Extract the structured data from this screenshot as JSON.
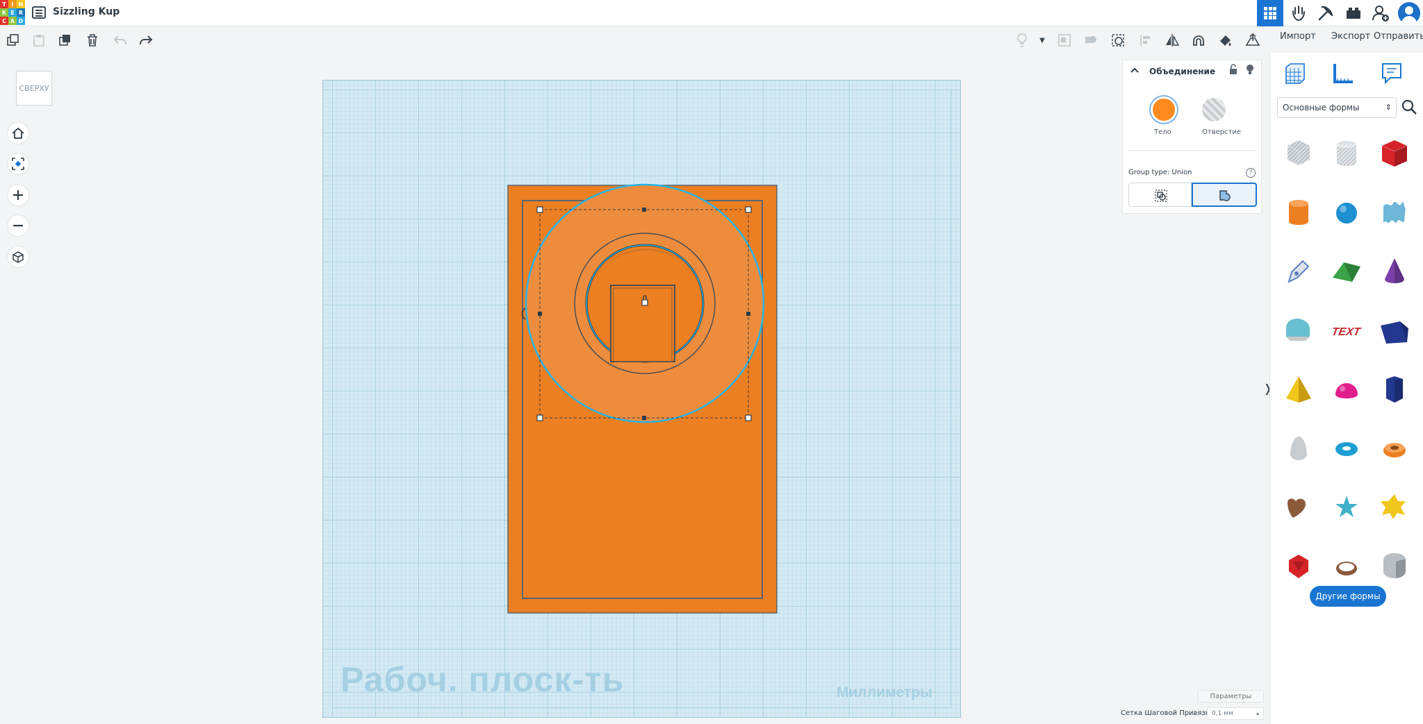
{
  "app": {
    "logo_letters": [
      "T",
      "I",
      "N",
      "K",
      "E",
      "R",
      "C",
      "A",
      "D"
    ],
    "logo_colors": [
      "#e2322b",
      "#f59b1c",
      "#f6c81b",
      "#8cc63f",
      "#2ea8e0",
      "#1b75bc",
      "#e2322b",
      "#8cc63f",
      "#2ea8e0"
    ],
    "project_title": "Sizzling Kup"
  },
  "header": {
    "icons": [
      "grid-view-icon",
      "gallery-icon",
      "pickaxe-icon",
      "bricks-icon",
      "add-user-icon",
      "user-avatar-icon"
    ],
    "accent": "#1a75d2"
  },
  "toolbar": {
    "left_icons": [
      "copy-icon",
      "paste-icon",
      "duplicate-icon",
      "delete-icon",
      "undo-icon",
      "redo-icon"
    ],
    "right_icons": [
      "light-bulb-icon",
      "chevron-down-icon",
      "group-icon",
      "ungroup-icon",
      "cruise-icon",
      "align-icon",
      "mirror-icon",
      "magnet-icon",
      "paint-icon",
      "workplane-icon"
    ],
    "import_label": "Импорт",
    "export_label": "Экспорт",
    "send_label": "Отправить"
  },
  "view": {
    "cube_face_label": "СВЕРХУ",
    "nav_icons": [
      "home-icon",
      "fit-view-icon",
      "zoom-in-icon",
      "zoom-out-icon",
      "perspective-icon"
    ]
  },
  "workplane": {
    "label": "Рабоч. плоск-ть",
    "units": "Миллиметры",
    "plane_color": "#d4eaf4",
    "shape_color": "#ec7f22",
    "selection_color": "#25b5e8"
  },
  "inspector": {
    "title": "Объединение",
    "solid_label": "Тело",
    "hole_label": "Отверстие",
    "solid_color": "#ff8a1e",
    "group_type_label": "Group type: Union",
    "help_symbol": "?"
  },
  "settings": {
    "params_label": "Параметры",
    "snap_label": "Сетка Шаговой Привязки",
    "snap_value": "0,1 мм"
  },
  "shapes_panel": {
    "tabs": [
      "workplane-tab-icon",
      "ruler-tab-icon",
      "notes-tab-icon"
    ],
    "category": "Основные формы",
    "more_label": "Другие формы",
    "collapse_symbol": "❭",
    "text_shape_label": "TEXT",
    "shapes": [
      {
        "name": "box-hole",
        "color": "#b9bec4"
      },
      {
        "name": "cylinder-hole",
        "color": "#c7ccd1"
      },
      {
        "name": "box",
        "color": "#d6232a"
      },
      {
        "name": "cylinder",
        "color": "#ec7f22"
      },
      {
        "name": "sphere",
        "color": "#1e8fd0"
      },
      {
        "name": "scribble",
        "color": "#6fb7d9"
      },
      {
        "name": "scribble-pen",
        "color": "#5a7fc0"
      },
      {
        "name": "roof",
        "color": "#3aa348"
      },
      {
        "name": "cone",
        "color": "#7a3fa8"
      },
      {
        "name": "round-roof",
        "color": "#68bfcf"
      },
      {
        "name": "text",
        "color": "#c8262c"
      },
      {
        "name": "wedge",
        "color": "#23388f"
      },
      {
        "name": "pyramid",
        "color": "#f1c61c"
      },
      {
        "name": "half-sphere",
        "color": "#e21e8c"
      },
      {
        "name": "polygon",
        "color": "#23388f"
      },
      {
        "name": "paraboloid",
        "color": "#c9ccce"
      },
      {
        "name": "torus",
        "color": "#1e9fd2"
      },
      {
        "name": "tube",
        "color": "#ec7f22"
      },
      {
        "name": "heart",
        "color": "#8a5a3b"
      },
      {
        "name": "star",
        "color": "#3fb0c9"
      },
      {
        "name": "star-six",
        "color": "#f1c61c"
      },
      {
        "name": "icosahedron",
        "color": "#d6232a"
      },
      {
        "name": "ring",
        "color": "#8a5a3b"
      },
      {
        "name": "rounded-box",
        "color": "#b9bec4"
      }
    ]
  }
}
